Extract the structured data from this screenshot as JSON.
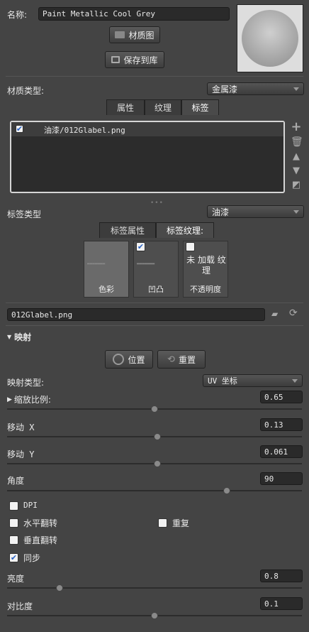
{
  "name": {
    "label": "名称:",
    "value": "Paint Metallic Cool Grey"
  },
  "buttons": {
    "material_map": "材质图",
    "save_to_library": "保存到库",
    "position": "位置",
    "reset": "重置"
  },
  "material_type": {
    "label": "材质类型:",
    "value": "金属漆"
  },
  "tabs": [
    {
      "label": "属性"
    },
    {
      "label": "纹理"
    },
    {
      "label": "标签",
      "active": true
    }
  ],
  "label_list": [
    {
      "checked": true,
      "text": "油漆/012Glabel.png"
    }
  ],
  "label_type": {
    "label": "标签类型",
    "value": "油漆"
  },
  "label_tabs": [
    {
      "label": "标签属性"
    },
    {
      "label": "标签纹理:",
      "active": true
    }
  ],
  "texture_slots": [
    {
      "caption": "色彩",
      "checked": null,
      "loaded": true
    },
    {
      "caption": "凹凸",
      "checked": true,
      "loaded": true
    },
    {
      "caption": "不透明度",
      "checked": false,
      "loaded": false,
      "empty_text": "未 加载 纹理"
    }
  ],
  "file": {
    "value": "012Glabel.png"
  },
  "mapping": {
    "title": "映射",
    "type_label": "映射类型:",
    "type_value": "UV 坐标",
    "scale": {
      "label": "缩放比例:",
      "value": "0.65",
      "slider": 0.5
    },
    "move_x": {
      "label": "移动 X",
      "value": "0.13",
      "slider": 0.51
    },
    "move_y": {
      "label": "移动 Y",
      "value": "0.061",
      "slider": 0.51
    },
    "angle": {
      "label": "角度",
      "value": "90",
      "slider": 0.75
    },
    "dpi": {
      "label": "DPI",
      "checked": false
    },
    "flip_h": {
      "label": "水平翻转",
      "checked": false
    },
    "repeat": {
      "label": "重复",
      "checked": false
    },
    "flip_v": {
      "label": "垂直翻转",
      "checked": false
    },
    "sync": {
      "label": "同步",
      "checked": true
    },
    "brightness": {
      "label": "亮度",
      "value": "0.8",
      "slider": 0.17
    },
    "contrast": {
      "label": "对比度",
      "value": "0.1",
      "slider": 0.5
    }
  },
  "colors": {
    "bg": "#444444",
    "field": "#2a2a2a",
    "check": "#2a63c4"
  }
}
